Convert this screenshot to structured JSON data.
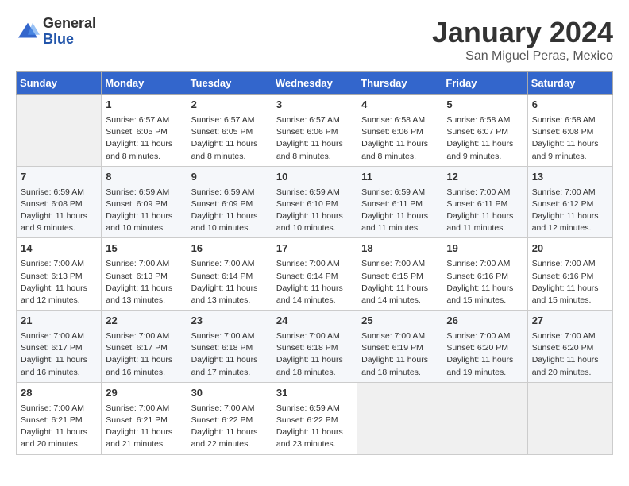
{
  "header": {
    "logo_line1": "General",
    "logo_line2": "Blue",
    "title": "January 2024",
    "subtitle": "San Miguel Peras, Mexico"
  },
  "weekdays": [
    "Sunday",
    "Monday",
    "Tuesday",
    "Wednesday",
    "Thursday",
    "Friday",
    "Saturday"
  ],
  "weeks": [
    [
      {
        "day": "",
        "info": ""
      },
      {
        "day": "1",
        "info": "Sunrise: 6:57 AM\nSunset: 6:05 PM\nDaylight: 11 hours\nand 8 minutes."
      },
      {
        "day": "2",
        "info": "Sunrise: 6:57 AM\nSunset: 6:05 PM\nDaylight: 11 hours\nand 8 minutes."
      },
      {
        "day": "3",
        "info": "Sunrise: 6:57 AM\nSunset: 6:06 PM\nDaylight: 11 hours\nand 8 minutes."
      },
      {
        "day": "4",
        "info": "Sunrise: 6:58 AM\nSunset: 6:06 PM\nDaylight: 11 hours\nand 8 minutes."
      },
      {
        "day": "5",
        "info": "Sunrise: 6:58 AM\nSunset: 6:07 PM\nDaylight: 11 hours\nand 9 minutes."
      },
      {
        "day": "6",
        "info": "Sunrise: 6:58 AM\nSunset: 6:08 PM\nDaylight: 11 hours\nand 9 minutes."
      }
    ],
    [
      {
        "day": "7",
        "info": "Sunrise: 6:59 AM\nSunset: 6:08 PM\nDaylight: 11 hours\nand 9 minutes."
      },
      {
        "day": "8",
        "info": "Sunrise: 6:59 AM\nSunset: 6:09 PM\nDaylight: 11 hours\nand 10 minutes."
      },
      {
        "day": "9",
        "info": "Sunrise: 6:59 AM\nSunset: 6:09 PM\nDaylight: 11 hours\nand 10 minutes."
      },
      {
        "day": "10",
        "info": "Sunrise: 6:59 AM\nSunset: 6:10 PM\nDaylight: 11 hours\nand 10 minutes."
      },
      {
        "day": "11",
        "info": "Sunrise: 6:59 AM\nSunset: 6:11 PM\nDaylight: 11 hours\nand 11 minutes."
      },
      {
        "day": "12",
        "info": "Sunrise: 7:00 AM\nSunset: 6:11 PM\nDaylight: 11 hours\nand 11 minutes."
      },
      {
        "day": "13",
        "info": "Sunrise: 7:00 AM\nSunset: 6:12 PM\nDaylight: 11 hours\nand 12 minutes."
      }
    ],
    [
      {
        "day": "14",
        "info": "Sunrise: 7:00 AM\nSunset: 6:13 PM\nDaylight: 11 hours\nand 12 minutes."
      },
      {
        "day": "15",
        "info": "Sunrise: 7:00 AM\nSunset: 6:13 PM\nDaylight: 11 hours\nand 13 minutes."
      },
      {
        "day": "16",
        "info": "Sunrise: 7:00 AM\nSunset: 6:14 PM\nDaylight: 11 hours\nand 13 minutes."
      },
      {
        "day": "17",
        "info": "Sunrise: 7:00 AM\nSunset: 6:14 PM\nDaylight: 11 hours\nand 14 minutes."
      },
      {
        "day": "18",
        "info": "Sunrise: 7:00 AM\nSunset: 6:15 PM\nDaylight: 11 hours\nand 14 minutes."
      },
      {
        "day": "19",
        "info": "Sunrise: 7:00 AM\nSunset: 6:16 PM\nDaylight: 11 hours\nand 15 minutes."
      },
      {
        "day": "20",
        "info": "Sunrise: 7:00 AM\nSunset: 6:16 PM\nDaylight: 11 hours\nand 15 minutes."
      }
    ],
    [
      {
        "day": "21",
        "info": "Sunrise: 7:00 AM\nSunset: 6:17 PM\nDaylight: 11 hours\nand 16 minutes."
      },
      {
        "day": "22",
        "info": "Sunrise: 7:00 AM\nSunset: 6:17 PM\nDaylight: 11 hours\nand 16 minutes."
      },
      {
        "day": "23",
        "info": "Sunrise: 7:00 AM\nSunset: 6:18 PM\nDaylight: 11 hours\nand 17 minutes."
      },
      {
        "day": "24",
        "info": "Sunrise: 7:00 AM\nSunset: 6:18 PM\nDaylight: 11 hours\nand 18 minutes."
      },
      {
        "day": "25",
        "info": "Sunrise: 7:00 AM\nSunset: 6:19 PM\nDaylight: 11 hours\nand 18 minutes."
      },
      {
        "day": "26",
        "info": "Sunrise: 7:00 AM\nSunset: 6:20 PM\nDaylight: 11 hours\nand 19 minutes."
      },
      {
        "day": "27",
        "info": "Sunrise: 7:00 AM\nSunset: 6:20 PM\nDaylight: 11 hours\nand 20 minutes."
      }
    ],
    [
      {
        "day": "28",
        "info": "Sunrise: 7:00 AM\nSunset: 6:21 PM\nDaylight: 11 hours\nand 20 minutes."
      },
      {
        "day": "29",
        "info": "Sunrise: 7:00 AM\nSunset: 6:21 PM\nDaylight: 11 hours\nand 21 minutes."
      },
      {
        "day": "30",
        "info": "Sunrise: 7:00 AM\nSunset: 6:22 PM\nDaylight: 11 hours\nand 22 minutes."
      },
      {
        "day": "31",
        "info": "Sunrise: 6:59 AM\nSunset: 6:22 PM\nDaylight: 11 hours\nand 23 minutes."
      },
      {
        "day": "",
        "info": ""
      },
      {
        "day": "",
        "info": ""
      },
      {
        "day": "",
        "info": ""
      }
    ]
  ]
}
